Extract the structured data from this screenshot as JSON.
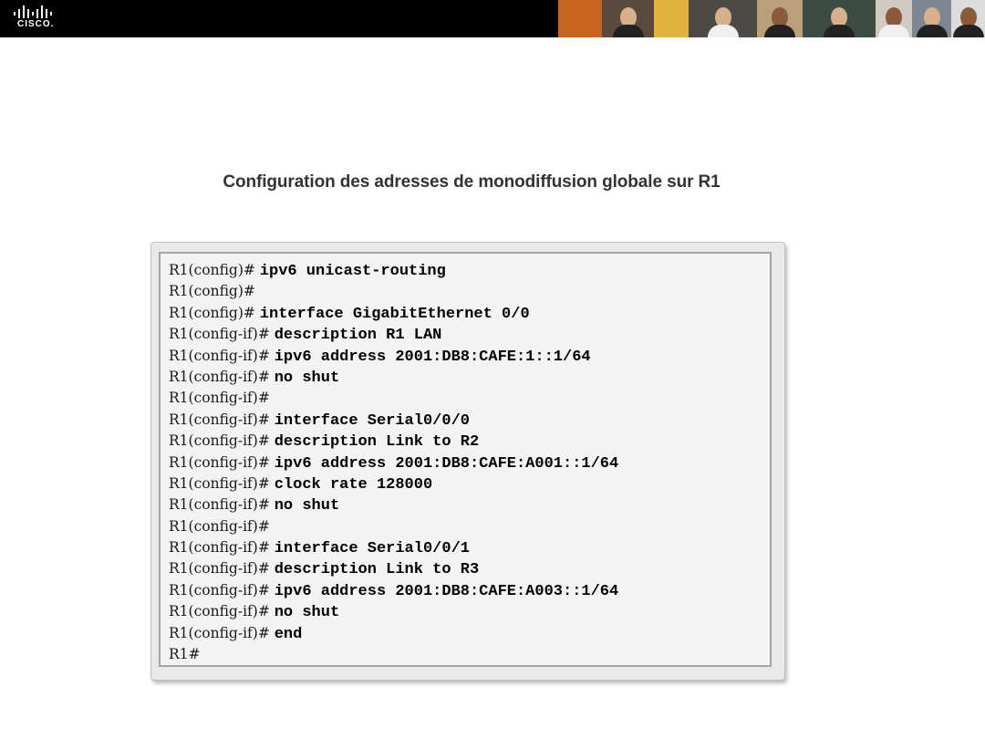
{
  "header": {
    "logo_text": "CISCO.",
    "photo_colors": [
      "#c8641e",
      "#5a4a3e",
      "#e3b23c",
      "#4d4a45",
      "#b9a07a",
      "#3c4b44",
      "#cfcac2",
      "#7d8791",
      "#dcdcdc"
    ]
  },
  "slide": {
    "title": "Configuration des adresses de monodiffusion globale sur R1"
  },
  "terminal": {
    "lines": [
      {
        "prompt": "R1(config)# ",
        "command": "ipv6 unicast-routing"
      },
      {
        "prompt": "R1(config)#",
        "command": ""
      },
      {
        "prompt": "R1(config)# ",
        "command": "interface GigabitEthernet 0/0"
      },
      {
        "prompt": "R1(config-if)# ",
        "command": "description R1 LAN"
      },
      {
        "prompt": "R1(config-if)# ",
        "command": "ipv6 address 2001:DB8:CAFE:1::1/64"
      },
      {
        "prompt": "R1(config-if)# ",
        "command": "no shut"
      },
      {
        "prompt": "R1(config-if)#",
        "command": ""
      },
      {
        "prompt": "R1(config-if)# ",
        "command": "interface Serial0/0/0"
      },
      {
        "prompt": "R1(config-if)# ",
        "command": "description Link to R2"
      },
      {
        "prompt": "R1(config-if)# ",
        "command": "ipv6 address 2001:DB8:CAFE:A001::1/64"
      },
      {
        "prompt": "R1(config-if)# ",
        "command": "clock rate 128000"
      },
      {
        "prompt": "R1(config-if)# ",
        "command": "no shut"
      },
      {
        "prompt": "R1(config-if)#",
        "command": ""
      },
      {
        "prompt": "R1(config-if)# ",
        "command": "interface Serial0/0/1"
      },
      {
        "prompt": "R1(config-if)# ",
        "command": "description Link to R3"
      },
      {
        "prompt": "R1(config-if)# ",
        "command": "ipv6 address 2001:DB8:CAFE:A003::1/64"
      },
      {
        "prompt": "R1(config-if)# ",
        "command": "no shut"
      },
      {
        "prompt": "R1(config-if)# ",
        "command": "end"
      },
      {
        "prompt": "R1#",
        "command": ""
      }
    ]
  }
}
